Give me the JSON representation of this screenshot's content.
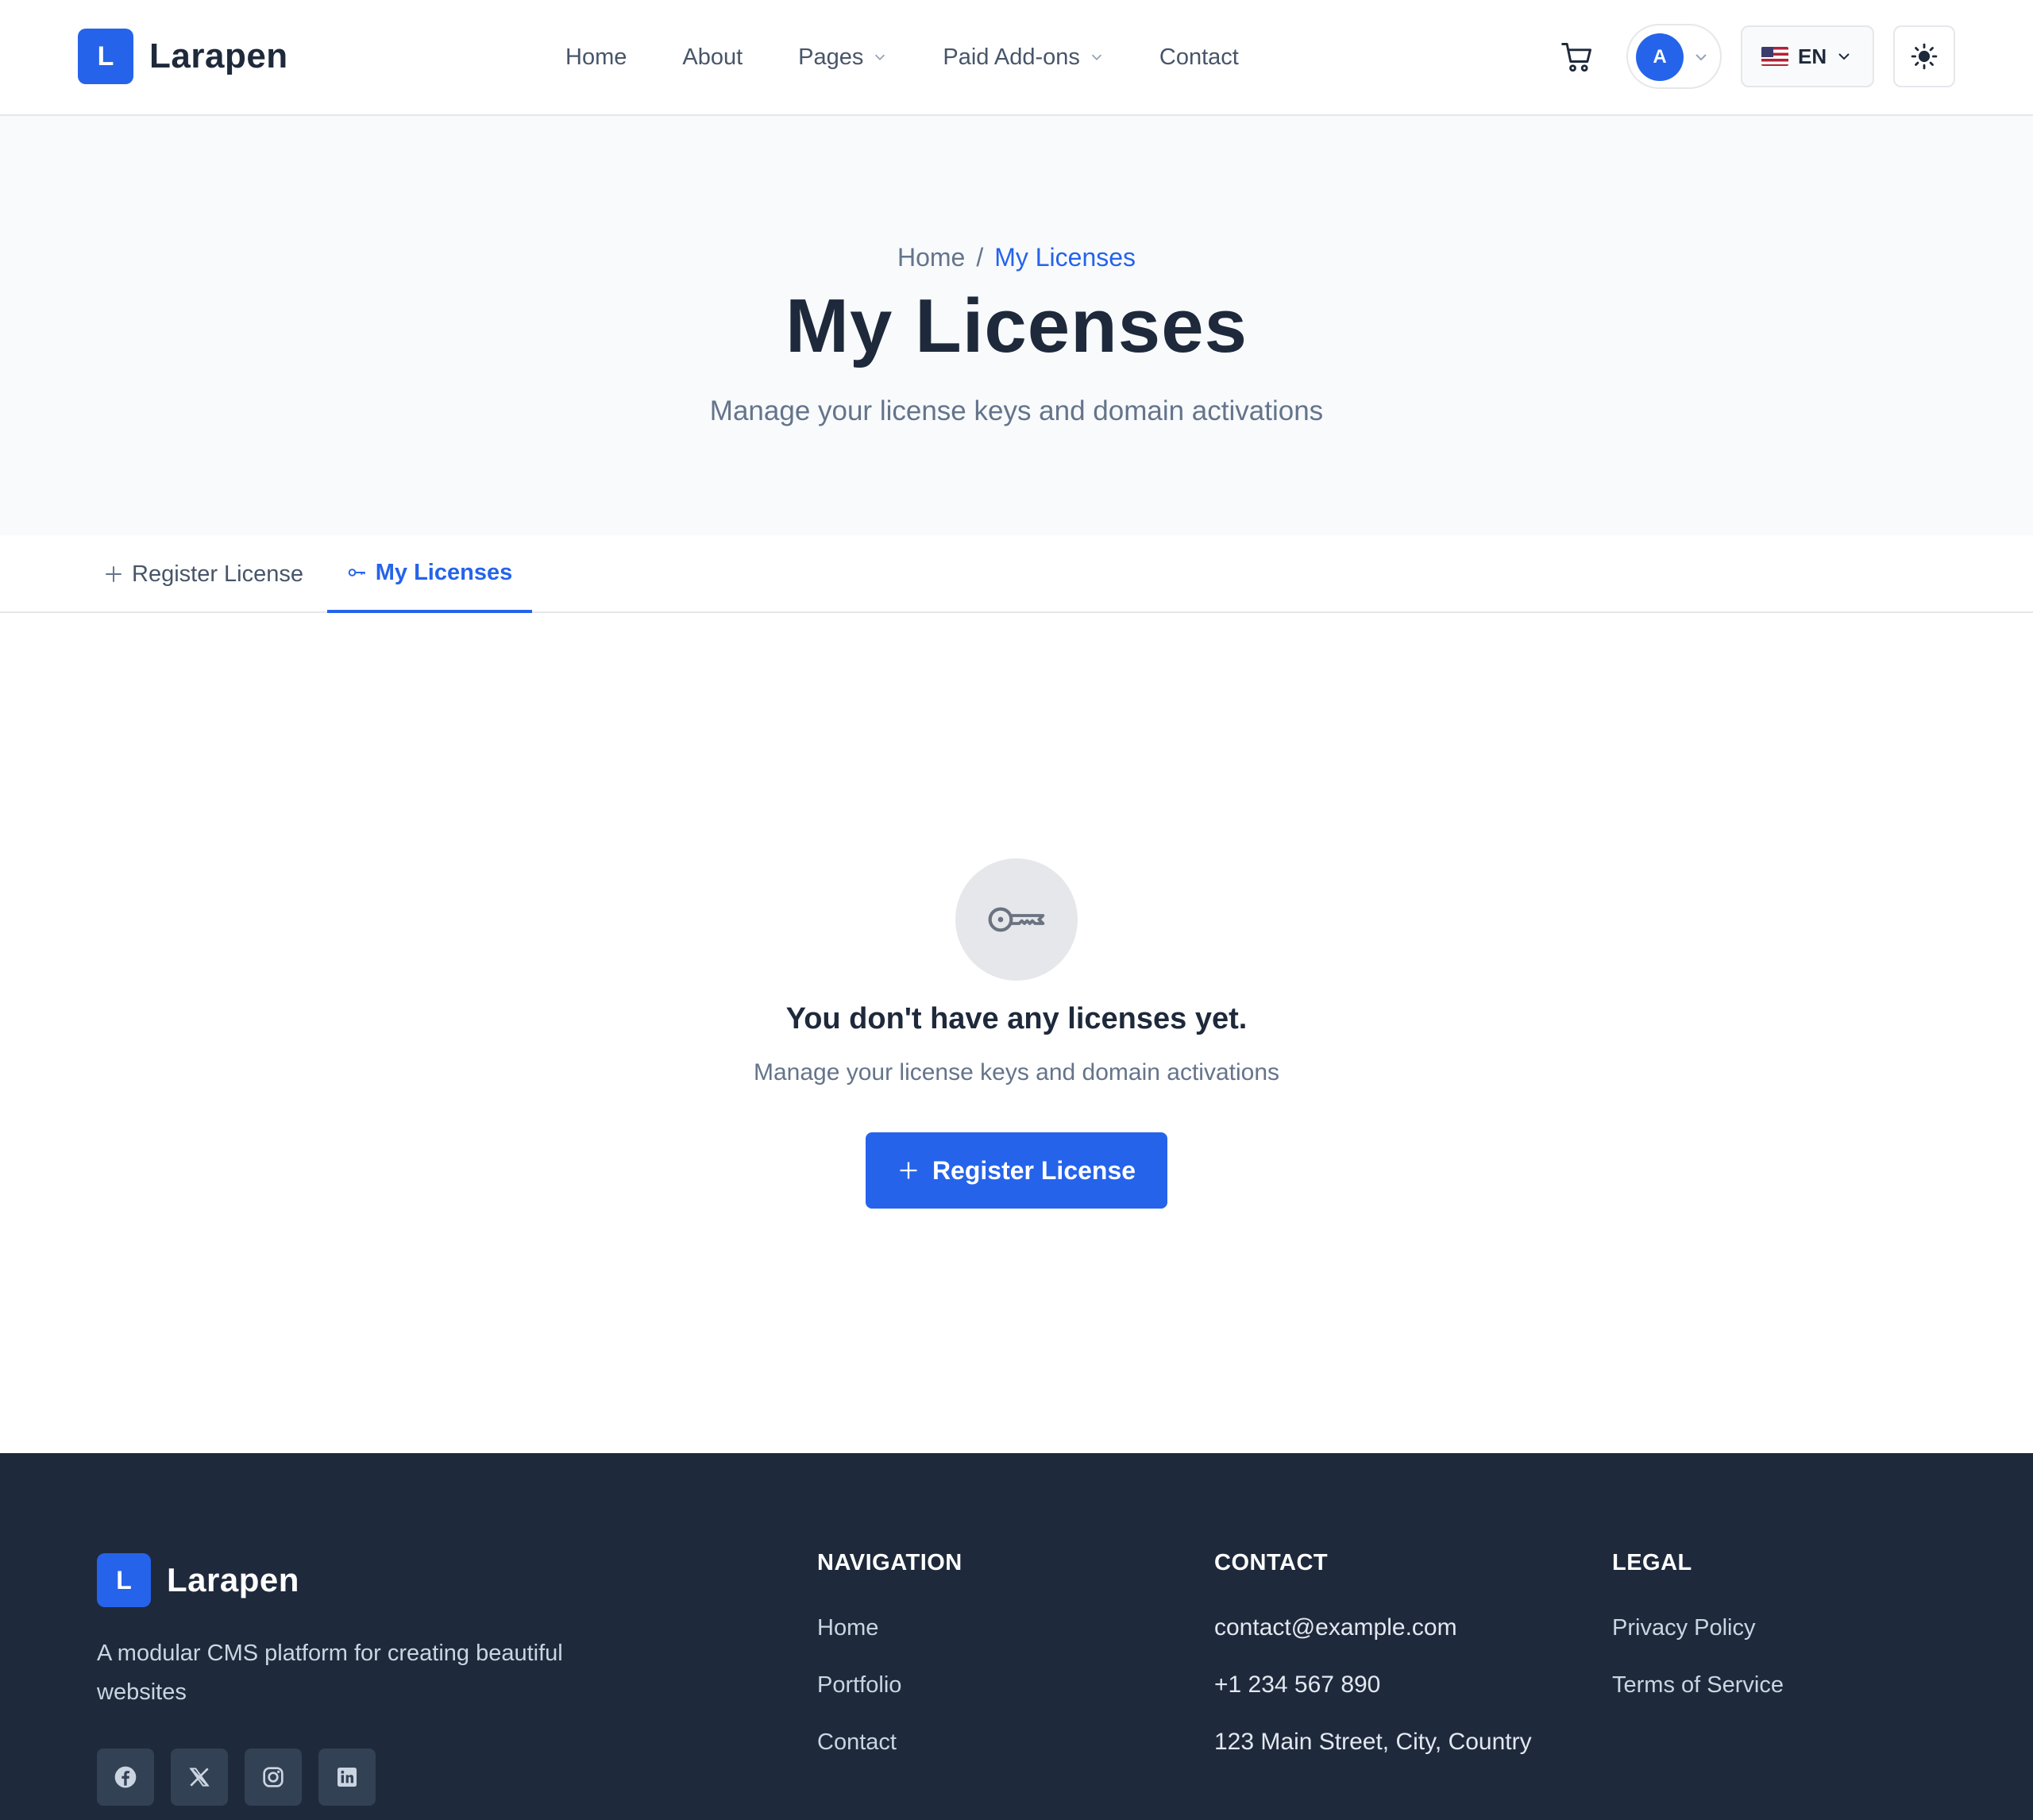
{
  "brand": {
    "initial": "L",
    "name": "Larapen"
  },
  "nav": {
    "links": [
      "Home",
      "About",
      "Pages",
      "Paid Add-ons",
      "Contact"
    ],
    "user_initial": "A",
    "language": "EN"
  },
  "hero": {
    "breadcrumb": {
      "home": "Home",
      "separator": "/",
      "current": "My Licenses"
    },
    "title": "My Licenses",
    "subtitle": "Manage your license keys and domain activations"
  },
  "tabs": {
    "register": "Register License",
    "licenses": "My Licenses",
    "active": "licenses"
  },
  "empty_state": {
    "icon": "key-icon",
    "title": "You don't have any licenses yet.",
    "subtitle": "Manage your license keys and domain activations",
    "cta_label": "Register License"
  },
  "footer": {
    "brand_initial": "L",
    "brand_name": "Larapen",
    "description": "A modular CMS platform for creating beautiful websites",
    "socials": [
      "facebook-icon",
      "x-icon",
      "instagram-icon",
      "linkedin-icon"
    ],
    "navigation": {
      "heading": "NAVIGATION",
      "items": [
        "Home",
        "Portfolio",
        "Contact"
      ]
    },
    "contact": {
      "heading": "CONTACT",
      "email": "contact@example.com",
      "phone": "+1 234 567 890",
      "address": "123 Main Street, City, Country"
    },
    "legal": {
      "heading": "LEGAL",
      "items": [
        "Privacy Policy",
        "Terms of Service"
      ]
    }
  },
  "colors": {
    "accent": "#2563eb",
    "footer_bg": "#1e293b",
    "hero_bg": "#f8fafc",
    "text": "#1e293b",
    "muted": "#64748b"
  }
}
